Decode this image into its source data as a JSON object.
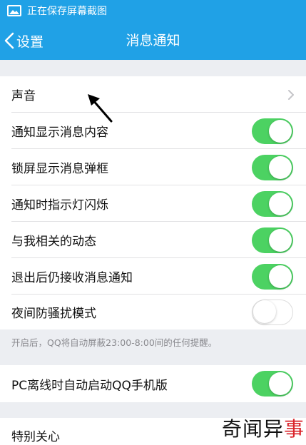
{
  "status_bar": {
    "text": "正在保存屏幕截图",
    "icon": "image-icon"
  },
  "nav": {
    "back_label": "设置",
    "title": "消息通知"
  },
  "sound_row": {
    "label": "声音"
  },
  "toggle_rows": [
    {
      "label": "通知显示消息内容",
      "on": true
    },
    {
      "label": "锁屏显示消息弹框",
      "on": true
    },
    {
      "label": "通知时指示灯闪烁",
      "on": true
    },
    {
      "label": "与我相关的动态",
      "on": true
    },
    {
      "label": "退出后仍接收消息通知",
      "on": true
    },
    {
      "label": "夜间防骚扰模式",
      "on": false
    }
  ],
  "hint": "开启后，QQ将自动屏蔽23:00-8:00间的任何提醒。",
  "pc_row": {
    "label": "PC离线时自动启动QQ手机版",
    "on": true
  },
  "special_row": {
    "label": "特别关心"
  },
  "watermark": {
    "text_dark": "奇闻异",
    "text_red": "事"
  },
  "colors": {
    "header": "#20a1e6",
    "toggle_on": "#4cd262",
    "background": "#eceef2"
  }
}
